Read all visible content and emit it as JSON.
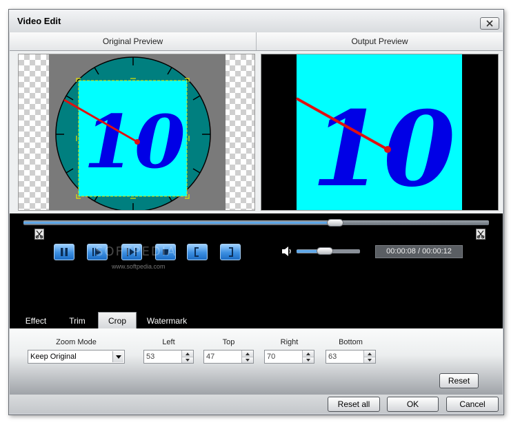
{
  "window": {
    "title": "Video Edit"
  },
  "preview": {
    "original_label": "Original Preview",
    "output_label": "Output Preview",
    "frame_number": "10"
  },
  "playback": {
    "seek_progress": 0.67,
    "volume_level": 0.45,
    "time_display": "00:00:08 / 00:00:12",
    "watermark_brand": "SOFTPEDIA",
    "watermark_url": "www.softpedia.com"
  },
  "tabs": [
    {
      "label": "Effect",
      "active": false
    },
    {
      "label": "Trim",
      "active": false
    },
    {
      "label": "Crop",
      "active": true
    },
    {
      "label": "Watermark",
      "active": false
    }
  ],
  "crop": {
    "zoom_mode_label": "Zoom Mode",
    "zoom_mode_value": "Keep Original",
    "left_label": "Left",
    "left_value": "53",
    "top_label": "Top",
    "top_value": "47",
    "right_label": "Right",
    "right_value": "70",
    "bottom_label": "Bottom",
    "bottom_value": "63",
    "reset_label": "Reset"
  },
  "footer": {
    "reset_all_label": "Reset all",
    "ok_label": "OK",
    "cancel_label": "Cancel"
  },
  "colors": {
    "accent_blue": "#3b8ee0",
    "clock_face": "#007f7f",
    "crop_area": "#00ffff",
    "numeral": "#0000e6",
    "clock_hand": "#e01010"
  }
}
